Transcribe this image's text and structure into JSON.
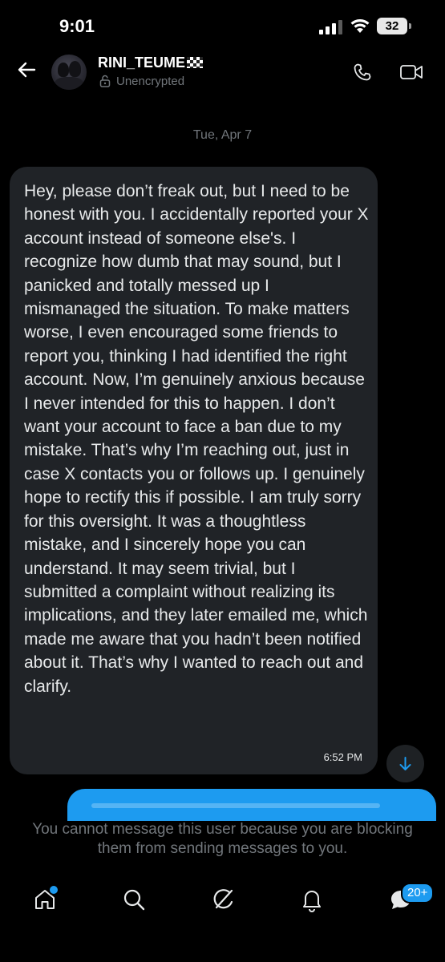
{
  "status_bar": {
    "time": "9:01",
    "battery": "32"
  },
  "header": {
    "contact_name": "RINI_TEUME",
    "encryption_status": "Unencrypted",
    "icons": [
      "back-arrow-icon",
      "lock-icon",
      "phone-icon",
      "video-call-icon"
    ]
  },
  "conversation": {
    "date": "Tue, Apr 7",
    "messages": [
      {
        "direction": "received",
        "text": "Hey, please don’t freak out, but I need to be honest with you. I accidentally reported your X account instead of someone else's. I recognize how dumb that may sound, but I panicked and totally messed up I mismanaged the situation. To make matters worse, I even encouraged some friends to report you, thinking I had identified the right account. Now, I’m genuinely anxious because I never intended for this to happen. I don’t want your account to face a ban due to my mistake. That’s why I’m reaching out, just in case X contacts you or follows up. I genuinely hope to rectify this if possible. I am truly sorry for this oversight. It was a thoughtless mistake, and I sincerely hope you can understand. It may seem trivial, but I submitted a complaint without realizing its implications, and they later emailed me, which made me aware that you hadn’t been notified about it. That’s why I wanted to reach out and clarify.",
        "time": "6:52 PM"
      }
    ]
  },
  "composer": {
    "blocked_notice": "You cannot message this user because you are blocking them from sending messages to you."
  },
  "bottom_nav": {
    "items": [
      "home-icon",
      "search-icon",
      "grok-icon",
      "notifications-icon",
      "messages-icon"
    ],
    "messages_badge": "20+"
  },
  "colors": {
    "background": "#000000",
    "bubble": "#202327",
    "accent": "#1d9bf0",
    "muted": "#71767b"
  }
}
